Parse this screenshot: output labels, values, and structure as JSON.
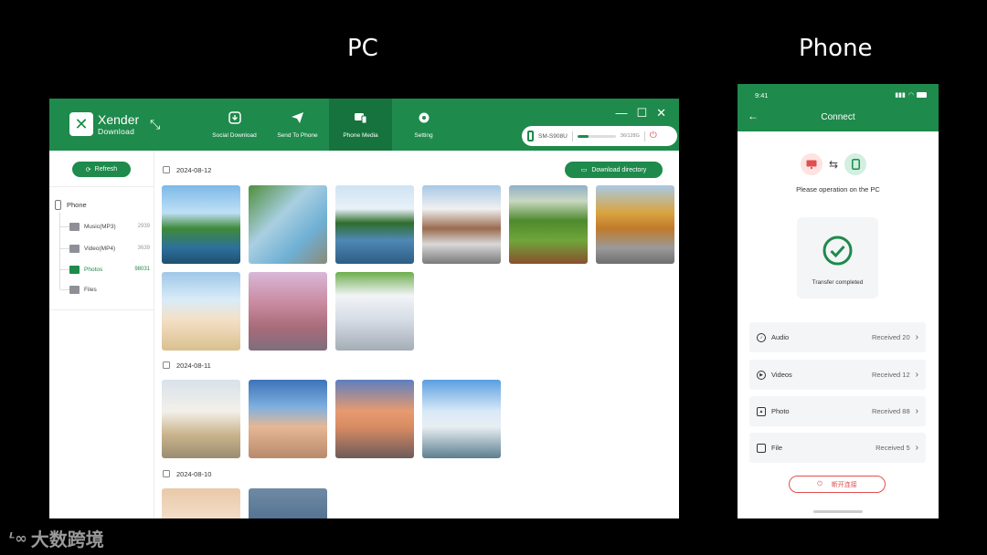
{
  "headings": {
    "pc": "PC",
    "phone": "Phone"
  },
  "pc_app": {
    "logo": {
      "name": "Xender",
      "subtitle": "Download"
    },
    "nav": [
      {
        "label": "Social Download",
        "icon": "social-download-icon"
      },
      {
        "label": "Send To Phone",
        "icon": "send-icon"
      },
      {
        "label": "Phone Media",
        "icon": "phone-media-icon",
        "active": true
      },
      {
        "label": "Setting",
        "icon": "gear-icon"
      }
    ],
    "device": {
      "name": "SM-S908U",
      "storage": "36/128G",
      "storage_fraction": 0.28
    },
    "sidebar": {
      "refresh_label": "Refresh",
      "root_label": "Phone",
      "items": [
        {
          "label": "Music(MP3)",
          "count": "2939"
        },
        {
          "label": "Video(MP4)",
          "count": "3639"
        },
        {
          "label": "Photos",
          "count": "98031",
          "active": true
        },
        {
          "label": "Files",
          "count": ""
        }
      ]
    },
    "download_label": "Download directory",
    "groups": [
      {
        "date": "2024-08-12",
        "photo_count": 9
      },
      {
        "date": "2024-08-11",
        "photo_count": 4
      },
      {
        "date": "2024-08-10",
        "photo_count": 2
      }
    ]
  },
  "phone_app": {
    "time": "9:41",
    "title": "Connect",
    "message": "Please operation on the PC",
    "status": "Transfer completed",
    "rows": [
      {
        "label": "Audio",
        "value": "Received 20",
        "icon": "music-icon"
      },
      {
        "label": "Videos",
        "value": "Received 12",
        "icon": "play-icon"
      },
      {
        "label": "Photo",
        "value": "Received 88",
        "icon": "image-icon"
      },
      {
        "label": "File",
        "value": "Received 5",
        "icon": "folder-icon"
      }
    ],
    "disconnect_label": "断开连接"
  },
  "watermark": "大数跨境",
  "colors": {
    "brand_green": "#1e8a4b",
    "danger_red": "#e05050"
  }
}
